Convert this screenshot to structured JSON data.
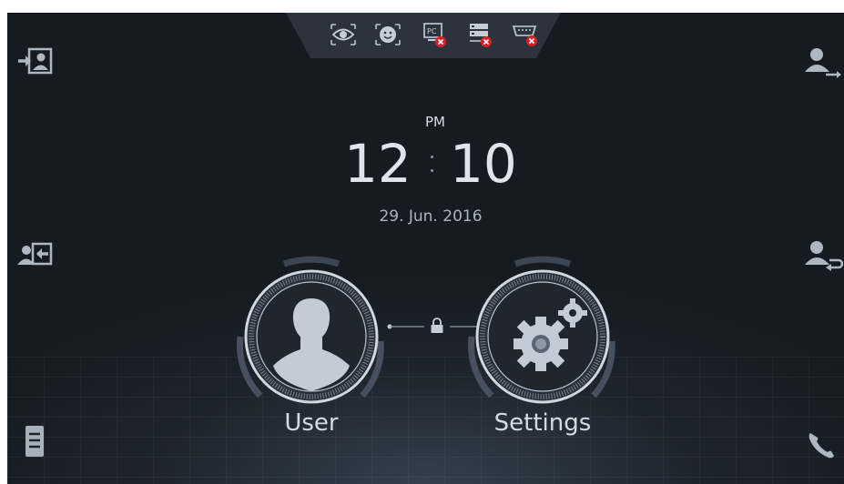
{
  "clock": {
    "ampm": "PM",
    "hour": "12",
    "minute": "10",
    "date": "29. Jun. 2016"
  },
  "status_icons": [
    {
      "icon": "eye-sensor-icon",
      "error": false
    },
    {
      "icon": "face-sensor-icon",
      "error": false
    },
    {
      "icon": "pc-icon",
      "error": true
    },
    {
      "icon": "server-icon",
      "error": true
    },
    {
      "icon": "serial-port-icon",
      "error": true
    }
  ],
  "side_buttons": {
    "left": [
      "login-icon",
      "logout-icon",
      "menu-list-icon"
    ],
    "right": [
      "user-out-icon",
      "user-return-icon",
      "phone-icon"
    ]
  },
  "main": {
    "user_label": "User",
    "settings_label": "Settings"
  },
  "colors": {
    "background": "#1d242c",
    "accent": "#c5ced8",
    "error": "#d81f2a"
  }
}
